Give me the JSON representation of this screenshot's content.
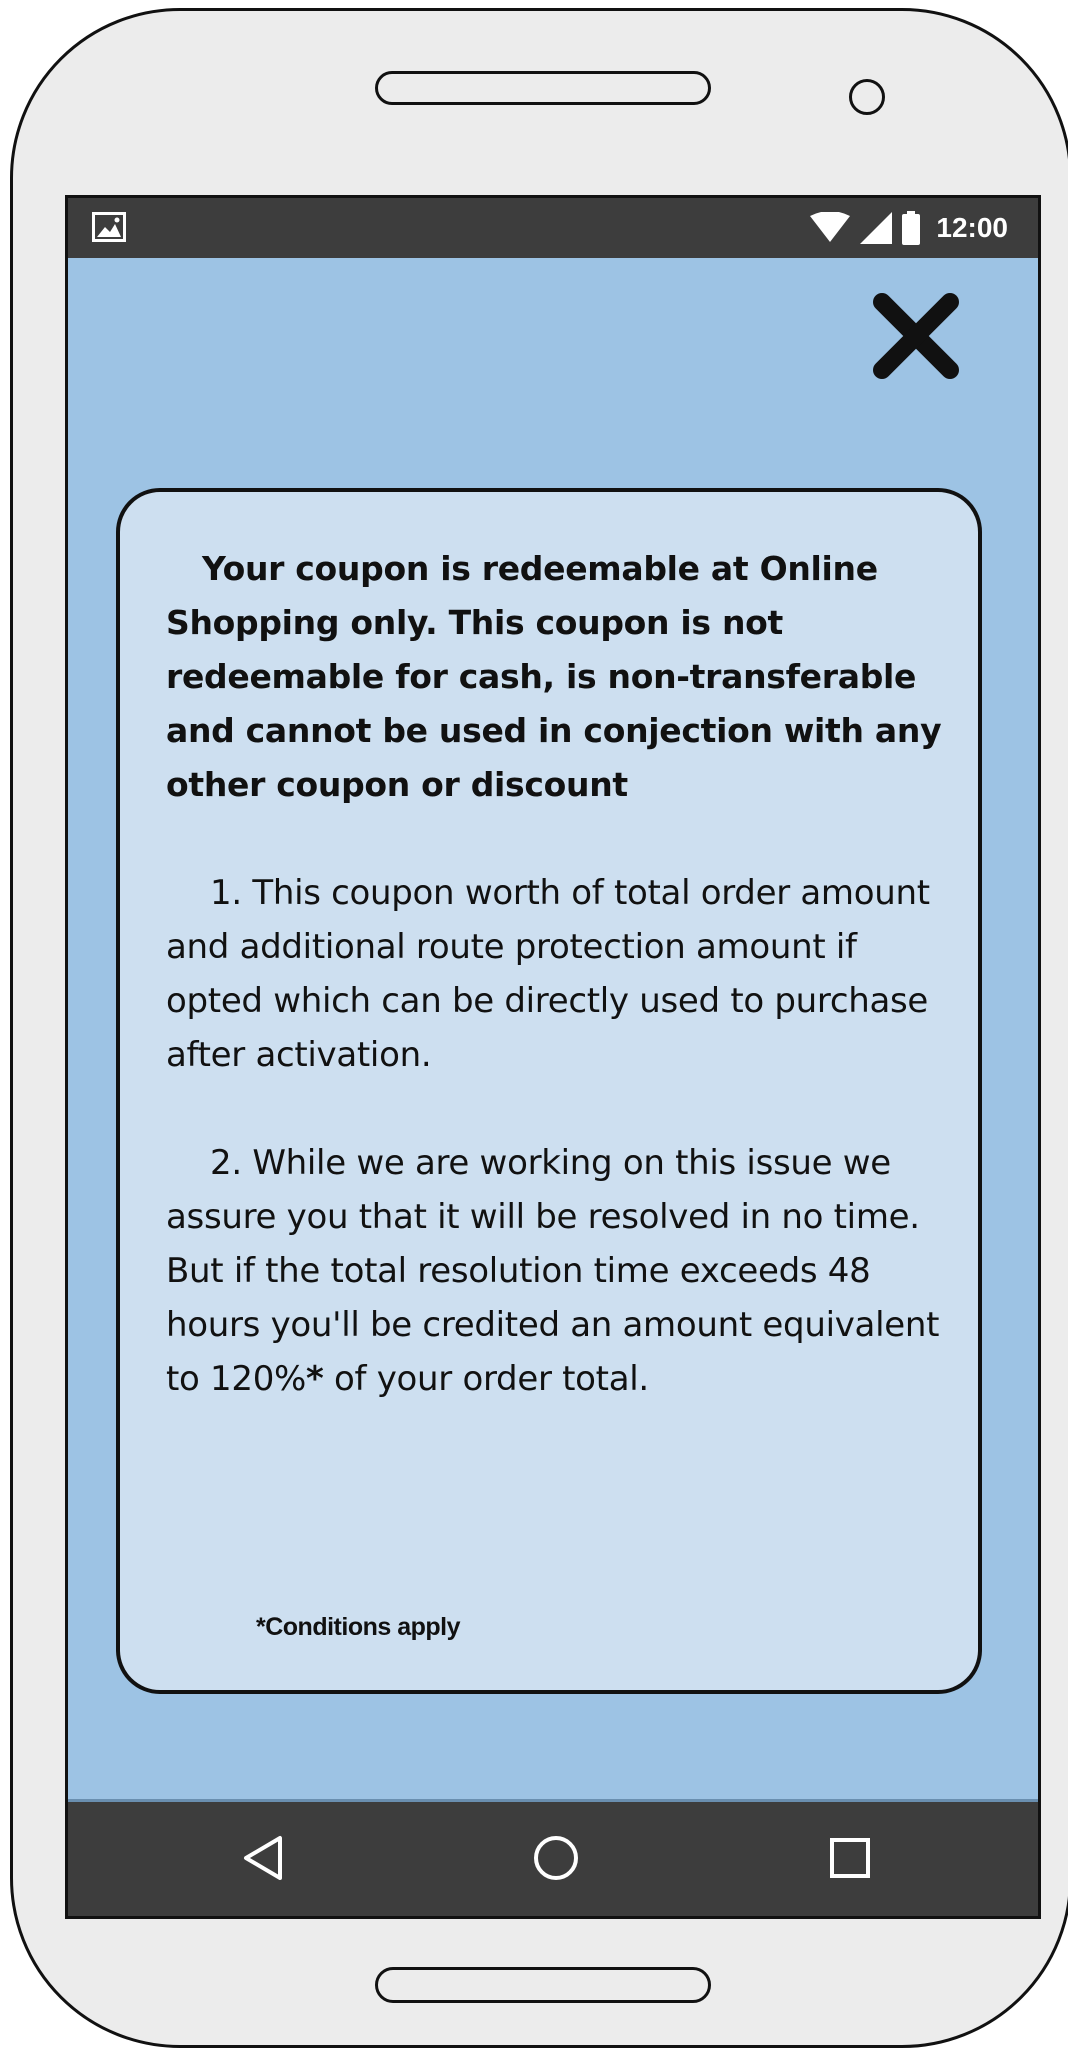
{
  "status_bar": {
    "time": "12:00",
    "icons": [
      "image-icon",
      "wifi-icon",
      "signal-icon",
      "battery-icon"
    ]
  },
  "modal": {
    "close_icon": "close-icon",
    "headline": "Your coupon is redeemable at Online Shopping only. This coupon is not redeemable for cash, is non-transferable and cannot be used in conjection with any other coupon or discount",
    "terms": [
      {
        "text": "1. This coupon worth of total order amount and additional route protection amount if opted which can be directly used to purchase after activation."
      },
      {
        "text_before": "2. While we are working on this issue we assure you that it will be resolved in no time. But if the total resolution time exceeds 48 hours you'll be credited an amount equivalent to 120%",
        "asterisk": "*",
        "text_after": " of your order total."
      }
    ],
    "conditions": "*Conditions apply"
  },
  "nav_bar": {
    "icons": [
      "back-icon",
      "home-icon",
      "recents-icon"
    ]
  },
  "colors": {
    "screen_background": "#9dc3e4",
    "card_background": "#cddff0",
    "bar_background": "#3d3d3d",
    "device_body": "#ececec"
  }
}
